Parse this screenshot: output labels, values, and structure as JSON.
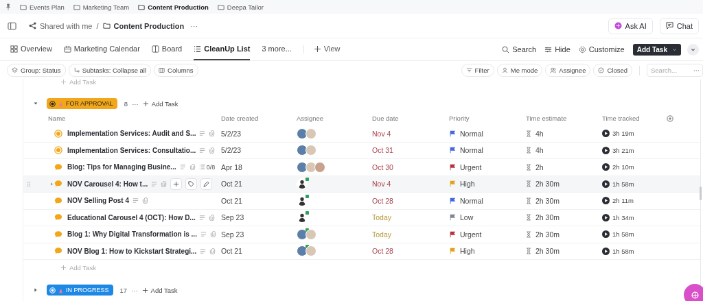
{
  "favorites": [
    {
      "label": "Events Plan",
      "selected": false
    },
    {
      "label": "Marketing Team",
      "selected": false
    },
    {
      "label": "Content Production",
      "selected": true
    },
    {
      "label": "Deepa Tailor",
      "selected": false
    }
  ],
  "breadcrumb": {
    "shared": "Shared with me",
    "separator": "/",
    "folder": "Content Production",
    "more": "···"
  },
  "header_buttons": [
    {
      "kind": "ai",
      "label": "Ask AI"
    },
    {
      "kind": "chat",
      "label": "Chat"
    }
  ],
  "views": [
    {
      "kind": "overview",
      "label": "Overview",
      "selected": false
    },
    {
      "kind": "calendar",
      "label": "Marketing Calendar",
      "selected": false
    },
    {
      "kind": "board",
      "label": "Board",
      "selected": false
    },
    {
      "kind": "list",
      "label": "CleanUp List",
      "selected": true
    }
  ],
  "more_views": "3 more...",
  "add_view": "View",
  "view_actions": [
    {
      "kind": "search",
      "label": "Search"
    },
    {
      "kind": "hide",
      "label": "Hide"
    },
    {
      "kind": "customize",
      "label": "Customize"
    }
  ],
  "add_task_button": "Add Task",
  "left_filters": [
    {
      "kind": "group",
      "label": "Group: Status"
    },
    {
      "kind": "subtasks",
      "label": "Subtasks: Collapse all"
    },
    {
      "kind": "columns",
      "label": "Columns"
    }
  ],
  "right_filters": [
    {
      "kind": "filter",
      "label": "Filter"
    },
    {
      "kind": "me",
      "label": "Me mode"
    },
    {
      "kind": "assignee",
      "label": "Assignee"
    },
    {
      "kind": "closed",
      "label": "Closed"
    }
  ],
  "search": {
    "placeholder": "Search..."
  },
  "previous_add_task": "Add Task",
  "groups": [
    {
      "name": "FOR APPROVAL",
      "color": "#f2a71b",
      "count": "8",
      "more": "···",
      "add_task": "Add Task",
      "expanded": true,
      "columns": [
        "Name",
        "Date created",
        "Assignee",
        "Due date",
        "Priority",
        "Time estimate",
        "Time tracked"
      ],
      "rows": [
        {
          "kind": "ring",
          "name": "Implementation Services: Audit and S...",
          "hovered": false,
          "date_created": "5/2/23",
          "assignees": [
            {
              "kind": "photo",
              "online": false
            },
            {
              "kind": "photo",
              "online": false
            }
          ],
          "due": "Nov 4",
          "due_today": false,
          "priority": "Normal",
          "color": "#4466e0",
          "estimate": "4h",
          "tracked": "3h 19m"
        },
        {
          "kind": "ring",
          "name": "Implementation Services: Consultatio...",
          "hovered": false,
          "date_created": "5/2/23",
          "assignees": [
            {
              "kind": "photo",
              "online": false
            },
            {
              "kind": "photo",
              "online": false
            }
          ],
          "due": "Oct 31",
          "due_today": false,
          "priority": "Normal",
          "color": "#4466e0",
          "estimate": "4h",
          "tracked": "3h 21m"
        },
        {
          "kind": "bubble",
          "name": "Blog: Tips for Managing Busine...",
          "subtasks": "0/8",
          "hovered": false,
          "date_created": "Apr 18",
          "assignees": [
            {
              "kind": "photo",
              "online": false
            },
            {
              "kind": "photo",
              "online": false
            },
            {
              "kind": "photo",
              "online": false
            }
          ],
          "due": "Oct 30",
          "due_today": false,
          "priority": "Urgent",
          "color": "#b8323c",
          "estimate": "2h",
          "tracked": "2h 10m"
        },
        {
          "kind": "bubble",
          "name": "NOV Carousel 4: How t...",
          "hovered": true,
          "date_created": "Oct 21",
          "assignees": [
            {
              "kind": "person",
              "online": true
            }
          ],
          "due": "Nov 4",
          "due_today": false,
          "priority": "High",
          "color": "#e0a21a",
          "estimate": "2h 30m",
          "tracked": "1h 58m"
        },
        {
          "kind": "bubble",
          "name": "NOV Selling Post 4",
          "hovered": false,
          "date_created": "Oct 21",
          "assignees": [
            {
              "kind": "person",
              "online": true
            }
          ],
          "due": "Oct 28",
          "due_today": false,
          "priority": "Normal",
          "color": "#4466e0",
          "estimate": "2h 30m",
          "tracked": "2h 11m"
        },
        {
          "kind": "bubble",
          "name": "Educational Carousel 4 (OCT): How D...",
          "hovered": false,
          "date_created": "Sep 23",
          "assignees": [
            {
              "kind": "person",
              "online": true
            }
          ],
          "due": "Today",
          "due_today": true,
          "priority": "Low",
          "color": "#7d8590",
          "estimate": "2h 30m",
          "tracked": "1h 34m"
        },
        {
          "kind": "bubble",
          "name": "Blog 1: Why Digital Transformation is ...",
          "hovered": false,
          "date_created": "Sep 23",
          "assignees": [
            {
              "kind": "photo",
              "online": true
            },
            {
              "kind": "photo",
              "online": false
            }
          ],
          "due": "Today",
          "due_today": true,
          "priority": "Urgent",
          "color": "#b8323c",
          "estimate": "2h 30m",
          "tracked": "1h 58m"
        },
        {
          "kind": "bubble",
          "name": "NOV Blog 1: How to Kickstart Strategi...",
          "hovered": false,
          "date_created": "Oct 21",
          "assignees": [
            {
              "kind": "photo",
              "online": true
            },
            {
              "kind": "photo",
              "online": false
            }
          ],
          "due": "Oct 28",
          "due_today": false,
          "priority": "High",
          "color": "#e0a21a",
          "estimate": "2h 30m",
          "tracked": "1h 58m"
        }
      ],
      "footer_add_task": "Add Task"
    },
    {
      "name": "IN PROGRESS",
      "color": "#1e88e5",
      "count": "17",
      "more": "···",
      "add_task": "Add Task",
      "expanded": false
    }
  ]
}
